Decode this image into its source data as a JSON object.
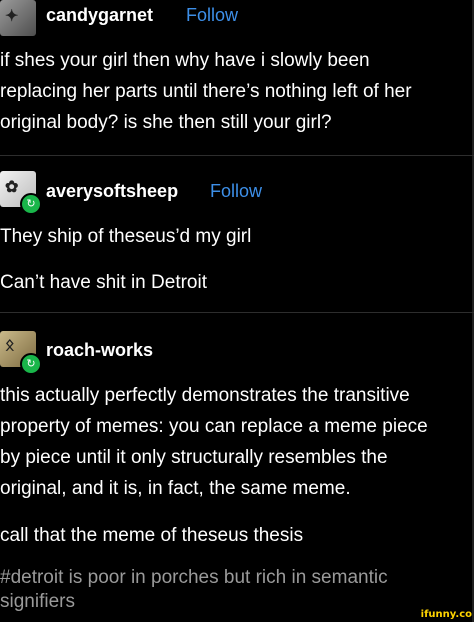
{
  "posts": [
    {
      "username": "candygarnet",
      "follow": "Follow",
      "lines": [
        "if shes your girl then why have i slowly been",
        "replacing her parts until there’s nothing left of her",
        "original body? is she then still your girl?"
      ]
    },
    {
      "username": "averysoftsheep",
      "follow": "Follow",
      "lines": [
        "They ship of theseus’d my girl",
        "Can’t have shit in Detroit"
      ]
    },
    {
      "username": "roach-works",
      "lines": [
        "this actually perfectly demonstrates the transitive",
        "property of memes: you can replace a meme piece",
        "by piece until it only structurally resembles the",
        "original, and it is, in fact, the same meme.",
        "call that the meme of theseus thesis"
      ],
      "tags": [
        "#detroit is poor in porches but rich in semantic",
        "signifiers"
      ]
    }
  ],
  "watermark": "ifunny.co",
  "icons": {
    "reblog": "reblog-icon",
    "avatar": "avatar-image"
  },
  "colors": {
    "background": "#000000",
    "follow": "#3d8fe8",
    "reblog": "#19b64a",
    "tags": "#9a9a9a"
  }
}
